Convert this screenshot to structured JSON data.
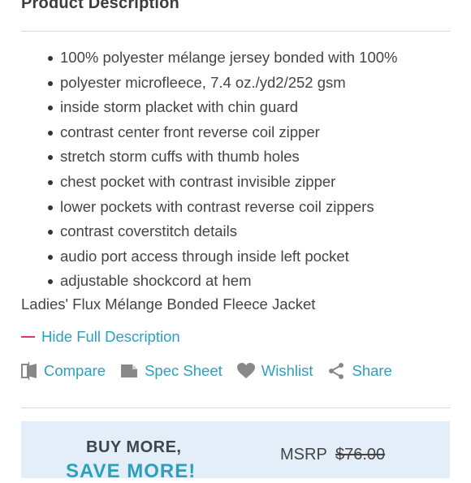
{
  "section": {
    "heading": "Product Description"
  },
  "features": [
    "100% polyester mélange jersey bonded with 100%",
    "polyester microfleece, 7.4 oz./yd2/252 gsm",
    "inside storm placket with chin guard",
    "contrast center front reverse coil zipper",
    "stretch storm cuffs with thumb holes",
    "chest pocket with contrast invisible zipper",
    "lower pockets with contrast reverse coil zippers",
    "contrast coverstitch details",
    "audio port access through inside left pocket",
    "adjustable shockcord at hem"
  ],
  "product_name": "Ladies' Flux Mélange Bonded Fleece Jacket",
  "toggle": {
    "label": "Hide Full Description"
  },
  "actions": {
    "compare": "Compare",
    "spec_sheet": "Spec Sheet",
    "wishlist": "Wishlist",
    "share": "Share"
  },
  "promo": {
    "title": "BUY MORE,",
    "subtitle": "SAVE MORE!",
    "msrp_label": "MSRP",
    "msrp_price": "$76.00"
  },
  "colors": {
    "accent": "#2c9fbd",
    "dash": "#d93a5e",
    "promo_bg": "#e3eef8",
    "icon": "#888888"
  },
  "icons": {
    "compare": "compare-icon",
    "spec_sheet": "document-icon",
    "wishlist": "heart-icon",
    "share": "share-icon"
  }
}
